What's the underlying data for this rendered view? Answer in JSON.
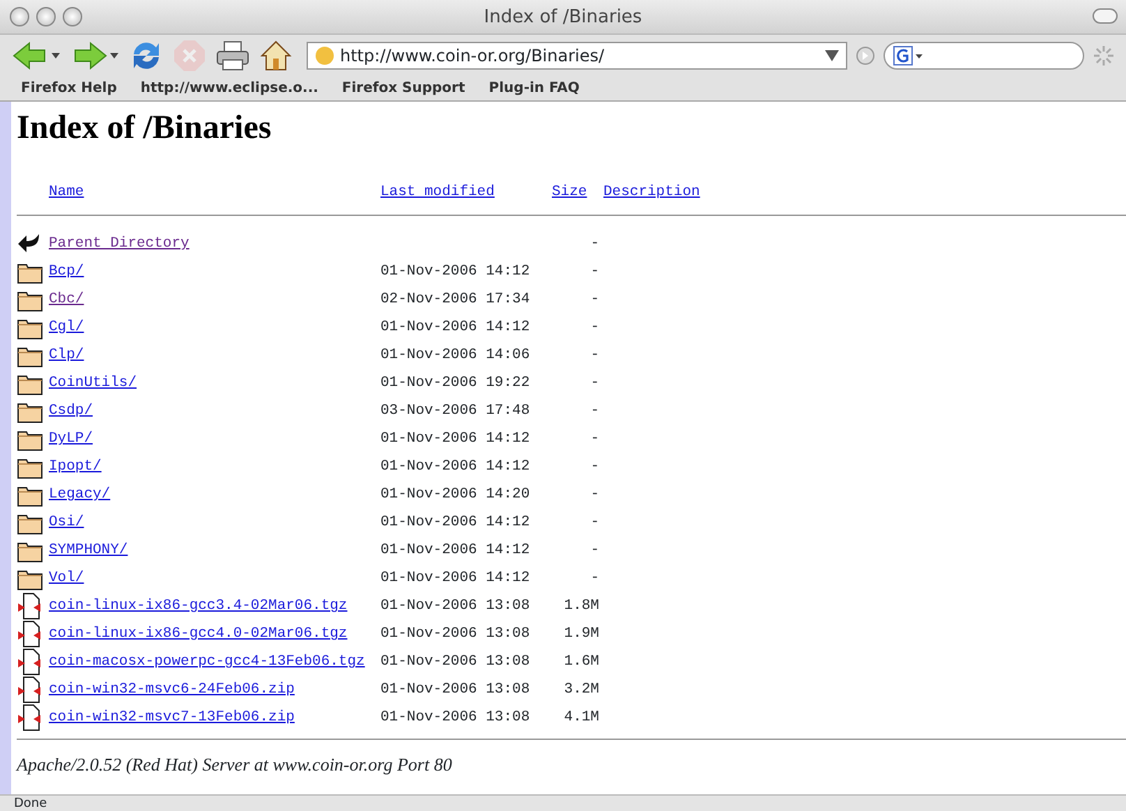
{
  "window": {
    "title": "Index of /Binaries"
  },
  "toolbar": {
    "buttons": [
      {
        "kind": "back",
        "disabled": false
      },
      {
        "kind": "forward",
        "disabled": false
      },
      {
        "kind": "reload",
        "disabled": false
      },
      {
        "kind": "stop",
        "disabled": true
      },
      {
        "kind": "print",
        "disabled": false
      },
      {
        "kind": "home",
        "disabled": false
      }
    ],
    "url": "http://www.coin-or.org/Binaries/"
  },
  "bookmarks": [
    "Firefox Help",
    "http://www.eclipse.o...",
    "Firefox Support",
    "Plug-in FAQ"
  ],
  "page": {
    "heading": "Index of /Binaries",
    "columns": [
      "Name",
      "Last modified",
      "Size",
      "Description"
    ],
    "rows": [
      {
        "kind": "parent",
        "name": "Parent Directory",
        "modified": "",
        "size": "-",
        "visited": true
      },
      {
        "kind": "folder",
        "name": "Bcp/",
        "modified": "01-Nov-2006 14:12",
        "size": "-",
        "visited": false
      },
      {
        "kind": "folder",
        "name": "Cbc/",
        "modified": "02-Nov-2006 17:34",
        "size": "-",
        "visited": true
      },
      {
        "kind": "folder",
        "name": "Cgl/",
        "modified": "01-Nov-2006 14:12",
        "size": "-",
        "visited": false
      },
      {
        "kind": "folder",
        "name": "Clp/",
        "modified": "01-Nov-2006 14:06",
        "size": "-",
        "visited": false
      },
      {
        "kind": "folder",
        "name": "CoinUtils/",
        "modified": "01-Nov-2006 19:22",
        "size": "-",
        "visited": false
      },
      {
        "kind": "folder",
        "name": "Csdp/",
        "modified": "03-Nov-2006 17:48",
        "size": "-",
        "visited": false
      },
      {
        "kind": "folder",
        "name": "DyLP/",
        "modified": "01-Nov-2006 14:12",
        "size": "-",
        "visited": false
      },
      {
        "kind": "folder",
        "name": "Ipopt/",
        "modified": "01-Nov-2006 14:12",
        "size": "-",
        "visited": false
      },
      {
        "kind": "folder",
        "name": "Legacy/",
        "modified": "01-Nov-2006 14:20",
        "size": "-",
        "visited": false
      },
      {
        "kind": "folder",
        "name": "Osi/",
        "modified": "01-Nov-2006 14:12",
        "size": "-",
        "visited": false
      },
      {
        "kind": "folder",
        "name": "SYMPHONY/",
        "modified": "01-Nov-2006 14:12",
        "size": "-",
        "visited": false
      },
      {
        "kind": "folder",
        "name": "Vol/",
        "modified": "01-Nov-2006 14:12",
        "size": "-",
        "visited": false
      },
      {
        "kind": "file",
        "name": "coin-linux-ix86-gcc3.4-02Mar06.tgz",
        "modified": "01-Nov-2006 13:08",
        "size": "1.8M",
        "visited": false
      },
      {
        "kind": "file",
        "name": "coin-linux-ix86-gcc4.0-02Mar06.tgz",
        "modified": "01-Nov-2006 13:08",
        "size": "1.9M",
        "visited": false
      },
      {
        "kind": "file",
        "name": "coin-macosx-powerpc-gcc4-13Feb06.tgz",
        "modified": "01-Nov-2006 13:08",
        "size": "1.6M",
        "visited": false
      },
      {
        "kind": "file",
        "name": "coin-win32-msvc6-24Feb06.zip",
        "modified": "01-Nov-2006 13:08",
        "size": "3.2M",
        "visited": false
      },
      {
        "kind": "file",
        "name": "coin-win32-msvc7-13Feb06.zip",
        "modified": "01-Nov-2006 13:08",
        "size": "4.1M",
        "visited": false
      }
    ],
    "footer": "Apache/2.0.52 (Red Hat) Server at www.coin-or.org Port 80"
  },
  "status_bar": "Done"
}
